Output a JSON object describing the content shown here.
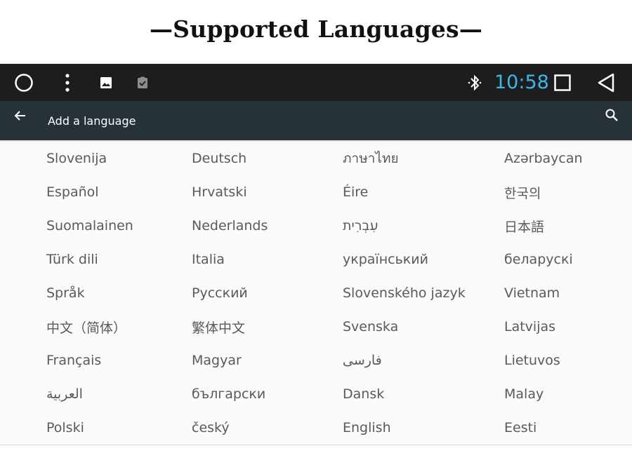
{
  "banner": {
    "title": "—Supported Languages—"
  },
  "statusbar": {
    "time": "10:58",
    "icons": [
      "home-circle-icon",
      "overflow-menu-icon",
      "image-icon",
      "clipboard-check-icon",
      "bluetooth-icon",
      "recents-square-icon",
      "back-triangle-icon"
    ],
    "clock_color": "#3fb7e6"
  },
  "appbar": {
    "title": "Add a language",
    "back_icon": "arrow-left-icon",
    "search_icon": "search-icon",
    "background": "#263238"
  },
  "languages": [
    [
      "Slovenija",
      "Deutsch",
      "ภาษาไทย",
      "Azərbaycan"
    ],
    [
      "Español",
      "Hrvatski",
      "Éire",
      "한국의"
    ],
    [
      "Suomalainen",
      "Nederlands",
      "עִבְרִית",
      "日本語"
    ],
    [
      "Türk dili",
      "Italia",
      "український",
      "беларускі"
    ],
    [
      "Språk",
      "Русский",
      "Slovenského jazyk",
      "Vietnam"
    ],
    [
      "中文（简体）",
      "繁体中文",
      "Svenska",
      "Latvijas"
    ],
    [
      "Français",
      "Magyar",
      "فارسی",
      "Lietuvos"
    ],
    [
      "العربية",
      "български",
      "Dansk",
      "Malay"
    ],
    [
      "Polski",
      "český",
      "English",
      "Eesti"
    ]
  ]
}
